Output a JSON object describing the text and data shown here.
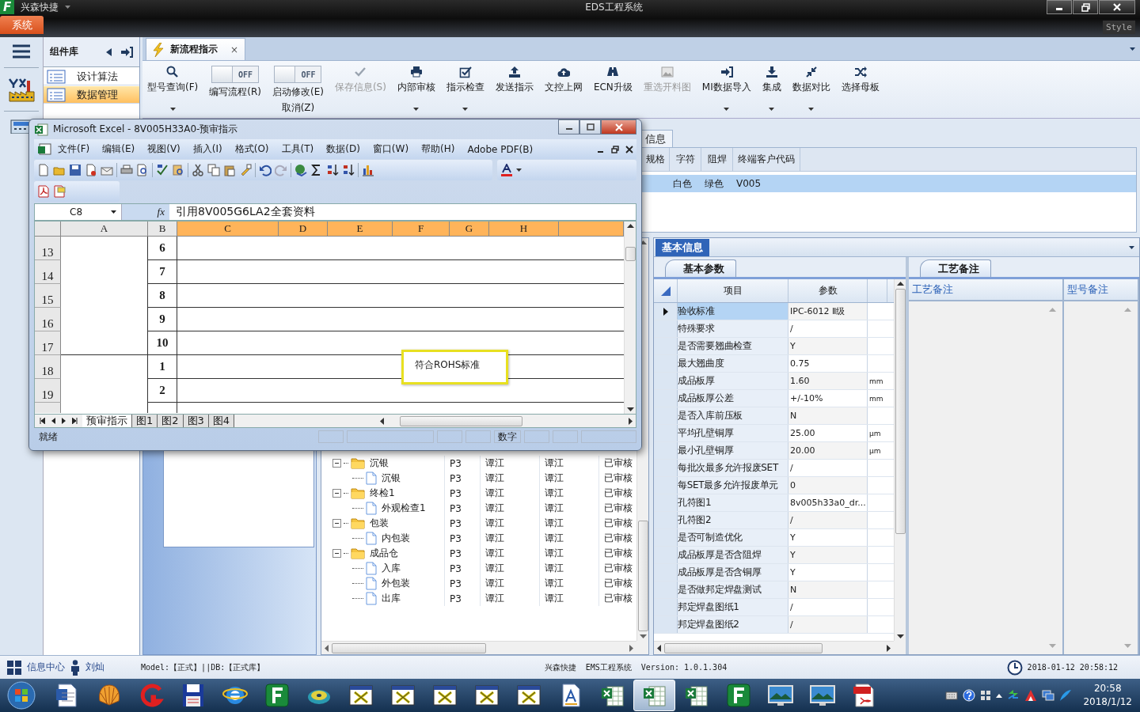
{
  "app": {
    "logo": "F",
    "name": "兴森快捷",
    "title": "EDS工程系统",
    "menu_tab": "系统",
    "style_label": "Style"
  },
  "component_panel": {
    "title": "组件库",
    "items": [
      {
        "label": "设计算法",
        "selected": false
      },
      {
        "label": "数据管理",
        "selected": true
      }
    ]
  },
  "doc_tab": {
    "label": "新流程指示",
    "close": "×"
  },
  "ribbon": [
    {
      "kind": "button",
      "label": "型号查询(F)",
      "disabled": false,
      "dropdown": true
    },
    {
      "kind": "toggle",
      "label": "编写流程(R)",
      "toggle_text": "OFF",
      "on": false
    },
    {
      "kind": "toggle",
      "label": "启动修改(E)",
      "label2": "取消(Z)",
      "toggle_text": "OFF",
      "on": false
    },
    {
      "kind": "button",
      "label": "保存信息(S)",
      "disabled": true,
      "dropdown": false
    },
    {
      "kind": "button",
      "label": "内部审核",
      "disabled": false,
      "dropdown": true
    },
    {
      "kind": "button",
      "label": "指示检查",
      "disabled": false,
      "dropdown": true
    },
    {
      "kind": "button",
      "label": "发送指示",
      "disabled": false,
      "dropdown": false
    },
    {
      "kind": "button",
      "label": "文控上网",
      "disabled": false,
      "dropdown": false
    },
    {
      "kind": "button",
      "label": "ECN升级",
      "disabled": false,
      "dropdown": false
    },
    {
      "kind": "button",
      "label": "重选开料图",
      "disabled": true,
      "dropdown": false
    },
    {
      "kind": "button",
      "label": "MI数据导入",
      "disabled": false,
      "dropdown": true
    },
    {
      "kind": "button",
      "label": "集成",
      "disabled": false,
      "dropdown": true
    },
    {
      "kind": "button",
      "label": "数据对比",
      "disabled": false,
      "dropdown": true
    },
    {
      "kind": "button",
      "label": "选择母板",
      "disabled": false,
      "dropdown": false
    }
  ],
  "upper_grid": {
    "tab": "信息",
    "columns": [
      "规格",
      "字符",
      "阻焊",
      "终端客户代码"
    ],
    "rows": [
      {
        "cells": [
          "",
          "白色",
          "绿色",
          "V005"
        ],
        "selected": true
      }
    ]
  },
  "excel": {
    "title": "Microsoft Excel - 8V005H33A0-预审指示",
    "menus": [
      "文件(F)",
      "编辑(E)",
      "视图(V)",
      "插入(I)",
      "格式(O)",
      "工具(T)",
      "数据(D)",
      "窗口(W)",
      "帮助(H)",
      "Adobe PDF(B)"
    ],
    "name_box": "C8",
    "fx": "fx",
    "formula": "引用8V005G6LA2全套资料",
    "columns": [
      "A",
      "B",
      "C",
      "D",
      "E",
      "F",
      "G",
      "H"
    ],
    "rows": [
      {
        "num": "13",
        "b": "6"
      },
      {
        "num": "14",
        "b": "7"
      },
      {
        "num": "15",
        "b": "8"
      },
      {
        "num": "16",
        "b": "9"
      },
      {
        "num": "17",
        "b": "10"
      },
      {
        "num": "18",
        "b": "1"
      },
      {
        "num": "19",
        "b": "2"
      }
    ],
    "comment": "符合ROHS标准",
    "sheets": [
      {
        "label": "预审指示",
        "selected": true
      },
      {
        "label": "图1",
        "selected": false
      },
      {
        "label": "图2",
        "selected": false
      },
      {
        "label": "图3",
        "selected": false
      },
      {
        "label": "图4",
        "selected": false
      }
    ],
    "status": "就绪",
    "status_mode": "数字"
  },
  "tree": [
    {
      "label": "沉银",
      "kind": "folder",
      "expanded": true,
      "cells": [
        "P3",
        "谭江",
        "谭江",
        "已审核"
      ],
      "children": [
        {
          "label": "沉银",
          "kind": "file",
          "cells": [
            "P3",
            "谭江",
            "谭江",
            "已审核"
          ]
        }
      ]
    },
    {
      "label": "终检1",
      "kind": "folder",
      "expanded": true,
      "cells": [
        "P3",
        "谭江",
        "谭江",
        "已审核"
      ],
      "children": [
        {
          "label": "外观检查1",
          "kind": "file",
          "cells": [
            "P3",
            "谭江",
            "谭江",
            "已审核"
          ]
        }
      ]
    },
    {
      "label": "包装",
      "kind": "folder",
      "expanded": true,
      "cells": [
        "P3",
        "谭江",
        "谭江",
        "已审核"
      ],
      "children": [
        {
          "label": "内包装",
          "kind": "file",
          "cells": [
            "P3",
            "谭江",
            "谭江",
            "已审核"
          ]
        }
      ]
    },
    {
      "label": "成品仓",
      "kind": "folder",
      "expanded": true,
      "cells": [
        "P3",
        "谭江",
        "谭江",
        "已审核"
      ],
      "children": [
        {
          "label": "入库",
          "kind": "file",
          "cells": [
            "P3",
            "谭江",
            "谭江",
            "已审核"
          ]
        },
        {
          "label": "外包装",
          "kind": "file",
          "cells": [
            "P3",
            "谭江",
            "谭江",
            "已审核"
          ]
        },
        {
          "label": "出库",
          "kind": "file",
          "cells": [
            "P3",
            "谭江",
            "谭江",
            "已审核"
          ]
        }
      ]
    }
  ],
  "info_panel": {
    "tab": "基本信息",
    "params": {
      "tab": "基本参数",
      "columns": [
        "项目",
        "参数"
      ],
      "rows": [
        {
          "item": "验收标准",
          "value": "IPC-6012 Ⅱ级",
          "selected": true
        },
        {
          "item": "特殊要求",
          "value": "/",
          "selected": false
        },
        {
          "item": "是否需要翘曲检查",
          "value": "Y",
          "selected": false
        },
        {
          "item": "最大翘曲度",
          "value": "0.75",
          "selected": false
        },
        {
          "item": "成品板厚",
          "value": "1.60",
          "unit": "mm",
          "selected": false
        },
        {
          "item": "成品板厚公差",
          "value": "+/-10%",
          "unit": "mm",
          "selected": false
        },
        {
          "item": "是否入库前压板",
          "value": "N",
          "selected": false
        },
        {
          "item": "平均孔壁铜厚",
          "value": "25.00",
          "unit": "μm",
          "selected": false
        },
        {
          "item": "最小孔壁铜厚",
          "value": "20.00",
          "unit": "μm",
          "selected": false
        },
        {
          "item": "每批次最多允许报废SET",
          "value": "/",
          "selected": false
        },
        {
          "item": "每SET最多允许报废单元",
          "value": "0",
          "selected": false
        },
        {
          "item": "孔符图1",
          "value": "8v005h33a0_dr...",
          "selected": false
        },
        {
          "item": "孔符图2",
          "value": "/",
          "selected": false
        },
        {
          "item": "是否可制造优化",
          "value": "Y",
          "selected": false
        },
        {
          "item": "成品板厚是否含阻焊",
          "value": "Y",
          "selected": false
        },
        {
          "item": "成品板厚是否含铜厚",
          "value": "Y",
          "selected": false
        },
        {
          "item": "是否做邦定焊盘测试",
          "value": "N",
          "selected": false
        },
        {
          "item": "邦定焊盘图纸1",
          "value": "/",
          "selected": false
        },
        {
          "item": "邦定焊盘图纸2",
          "value": "/",
          "selected": false
        }
      ]
    },
    "notes": {
      "tab": "工艺备注",
      "columns": [
        "工艺备注",
        "型号备注"
      ]
    }
  },
  "status_bar": {
    "info_center": "信息中心",
    "user": "刘灿",
    "model": "Model:【正式】||DB:【正式库】",
    "product": "兴森快捷  EMS工程系统  Version: 1.0.1.304",
    "datetime": "2018-01-12 20:58:12"
  },
  "taskbar": {
    "apps": [
      {
        "kind": "word",
        "selected": false
      },
      {
        "kind": "shell",
        "selected": false
      },
      {
        "kind": "swirl",
        "selected": false
      },
      {
        "kind": "floppy",
        "selected": false
      },
      {
        "kind": "globe",
        "selected": false
      },
      {
        "kind": "tile",
        "selected": false
      },
      {
        "kind": "disc",
        "selected": false
      },
      {
        "kind": "window",
        "selected": false
      },
      {
        "kind": "window",
        "selected": false
      },
      {
        "kind": "window",
        "selected": false
      },
      {
        "kind": "window",
        "selected": false
      },
      {
        "kind": "window",
        "selected": false
      },
      {
        "kind": "document",
        "selected": false
      },
      {
        "kind": "spreadsheet",
        "selected": false
      },
      {
        "kind": "spreadsheet",
        "selected": true
      },
      {
        "kind": "spreadsheet",
        "selected": false
      },
      {
        "kind": "tile",
        "selected": false
      },
      {
        "kind": "monitor",
        "selected": false
      },
      {
        "kind": "monitor",
        "selected": false
      },
      {
        "kind": "pdf",
        "selected": false
      }
    ],
    "time": "20:58",
    "date": "2018/1/12"
  }
}
